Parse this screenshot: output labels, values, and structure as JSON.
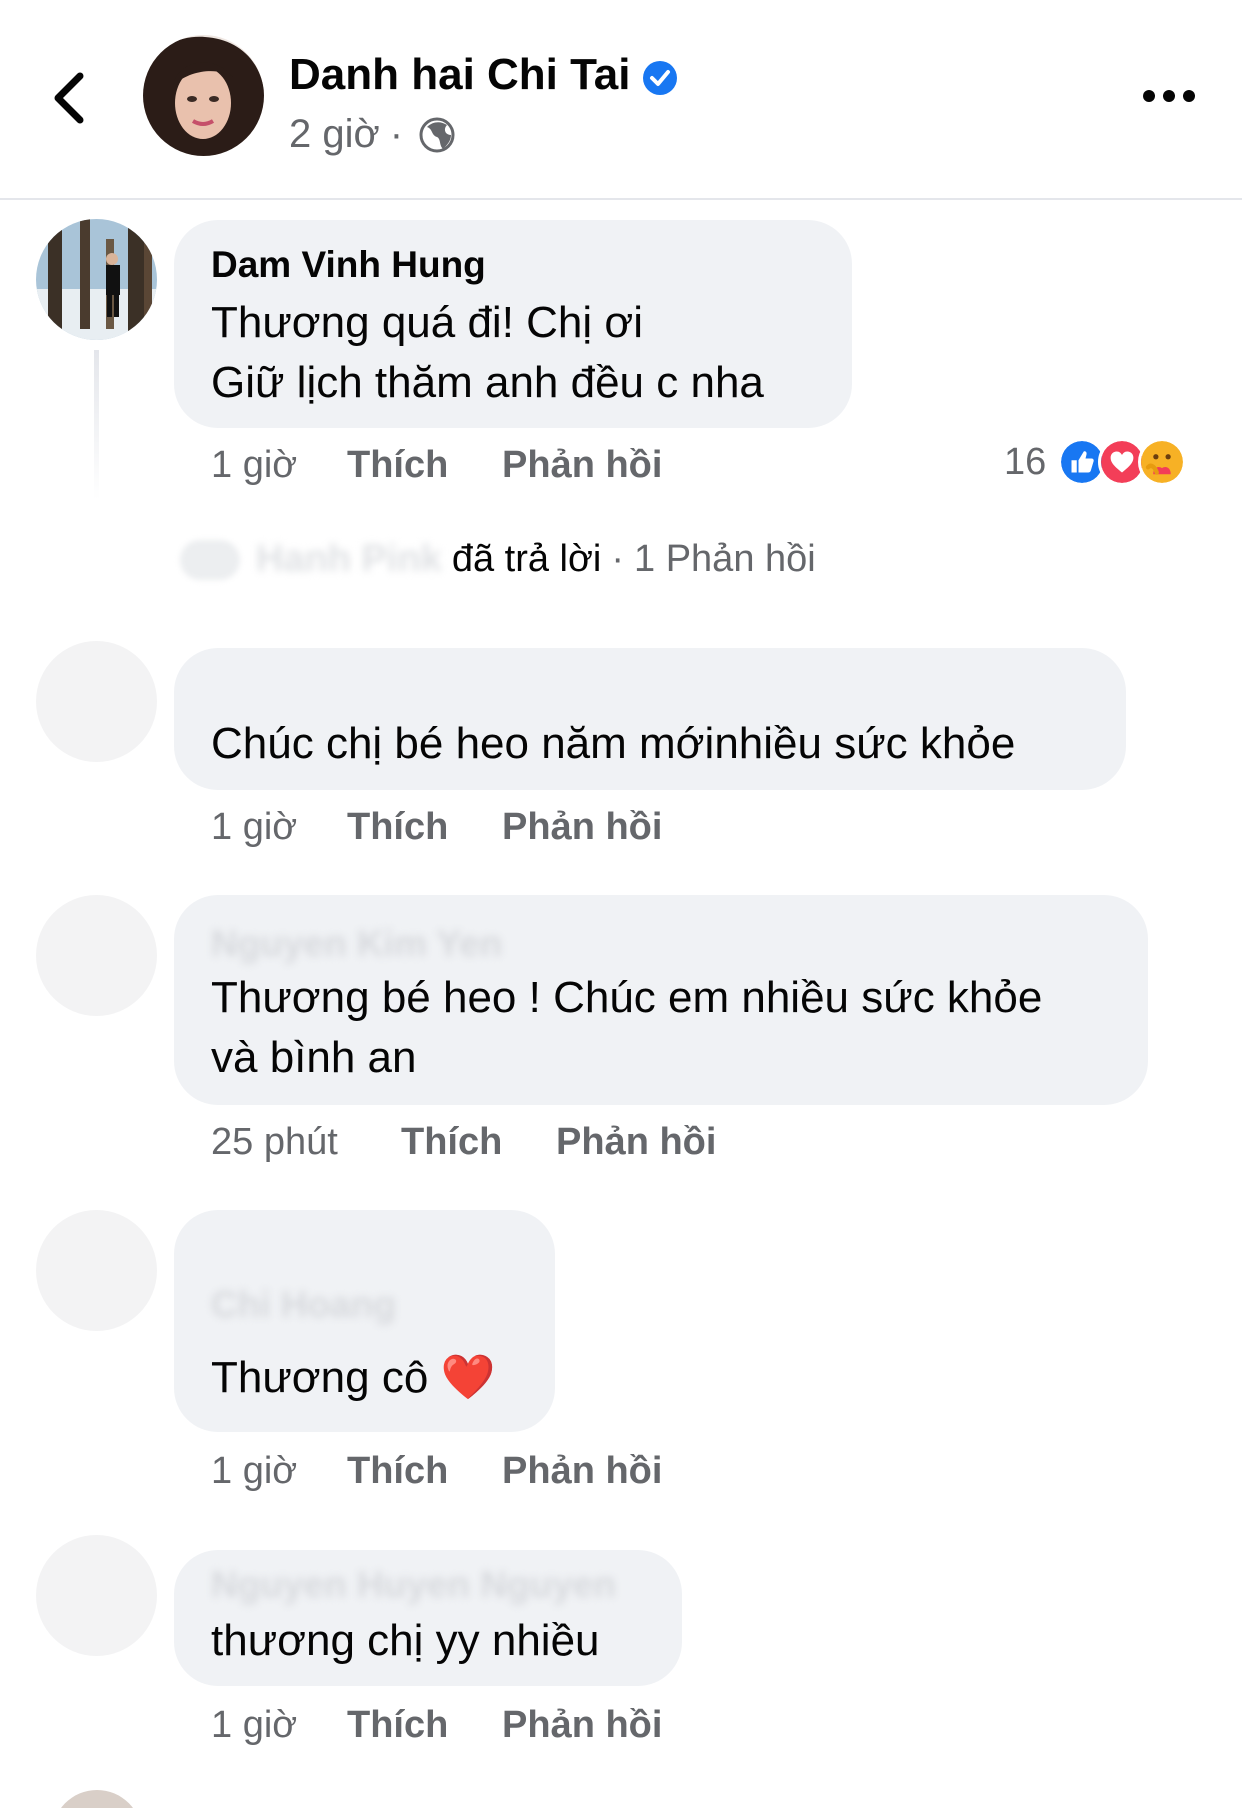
{
  "header": {
    "page_name": "Danh hai Chi Tai",
    "time": "2 giờ",
    "separator": "·",
    "icons": {
      "back": "back-arrow-icon",
      "verified": "verified-badge-icon",
      "audience": "globe-icon",
      "more": "more-icon"
    },
    "colors": {
      "verified": "#1877f2"
    }
  },
  "comments": [
    {
      "author": "Dam Vinh Hung",
      "lines": [
        "Thương quá đi! Chị ơi",
        "Giữ lịch thăm anh đều c nha"
      ],
      "time": "1 giờ",
      "like": "Thích",
      "reply": "Phản hồi",
      "reactions": {
        "count": "16",
        "types": [
          "like",
          "love",
          "care"
        ]
      },
      "replies": {
        "replier": "Hanh Pink",
        "replied": "đã trả lời",
        "separator": "·",
        "count": "1 Phản hồi"
      }
    },
    {
      "author": "",
      "lines": [
        "Chúc chị bé heo năm mớinhiều sức khỏe"
      ],
      "time": "1 giờ",
      "like": "Thích",
      "reply": "Phản hồi"
    },
    {
      "author": "Nguyen Kim Yen",
      "lines": [
        "Thương bé heo ! Chúc em nhiều sức khỏe",
        "và bình an"
      ],
      "time": "25 phút",
      "like": "Thích",
      "reply": "Phản hồi"
    },
    {
      "author": "Chi Hoang",
      "lines": [
        "Thương cô ❤️"
      ],
      "time": "1 giờ",
      "like": "Thích",
      "reply": "Phản hồi"
    },
    {
      "author": "Nguyen Huyen Nguyen",
      "lines": [
        "thương chị yy nhiều"
      ],
      "time": "1 giờ",
      "like": "Thích",
      "reply": "Phản hồi"
    }
  ]
}
